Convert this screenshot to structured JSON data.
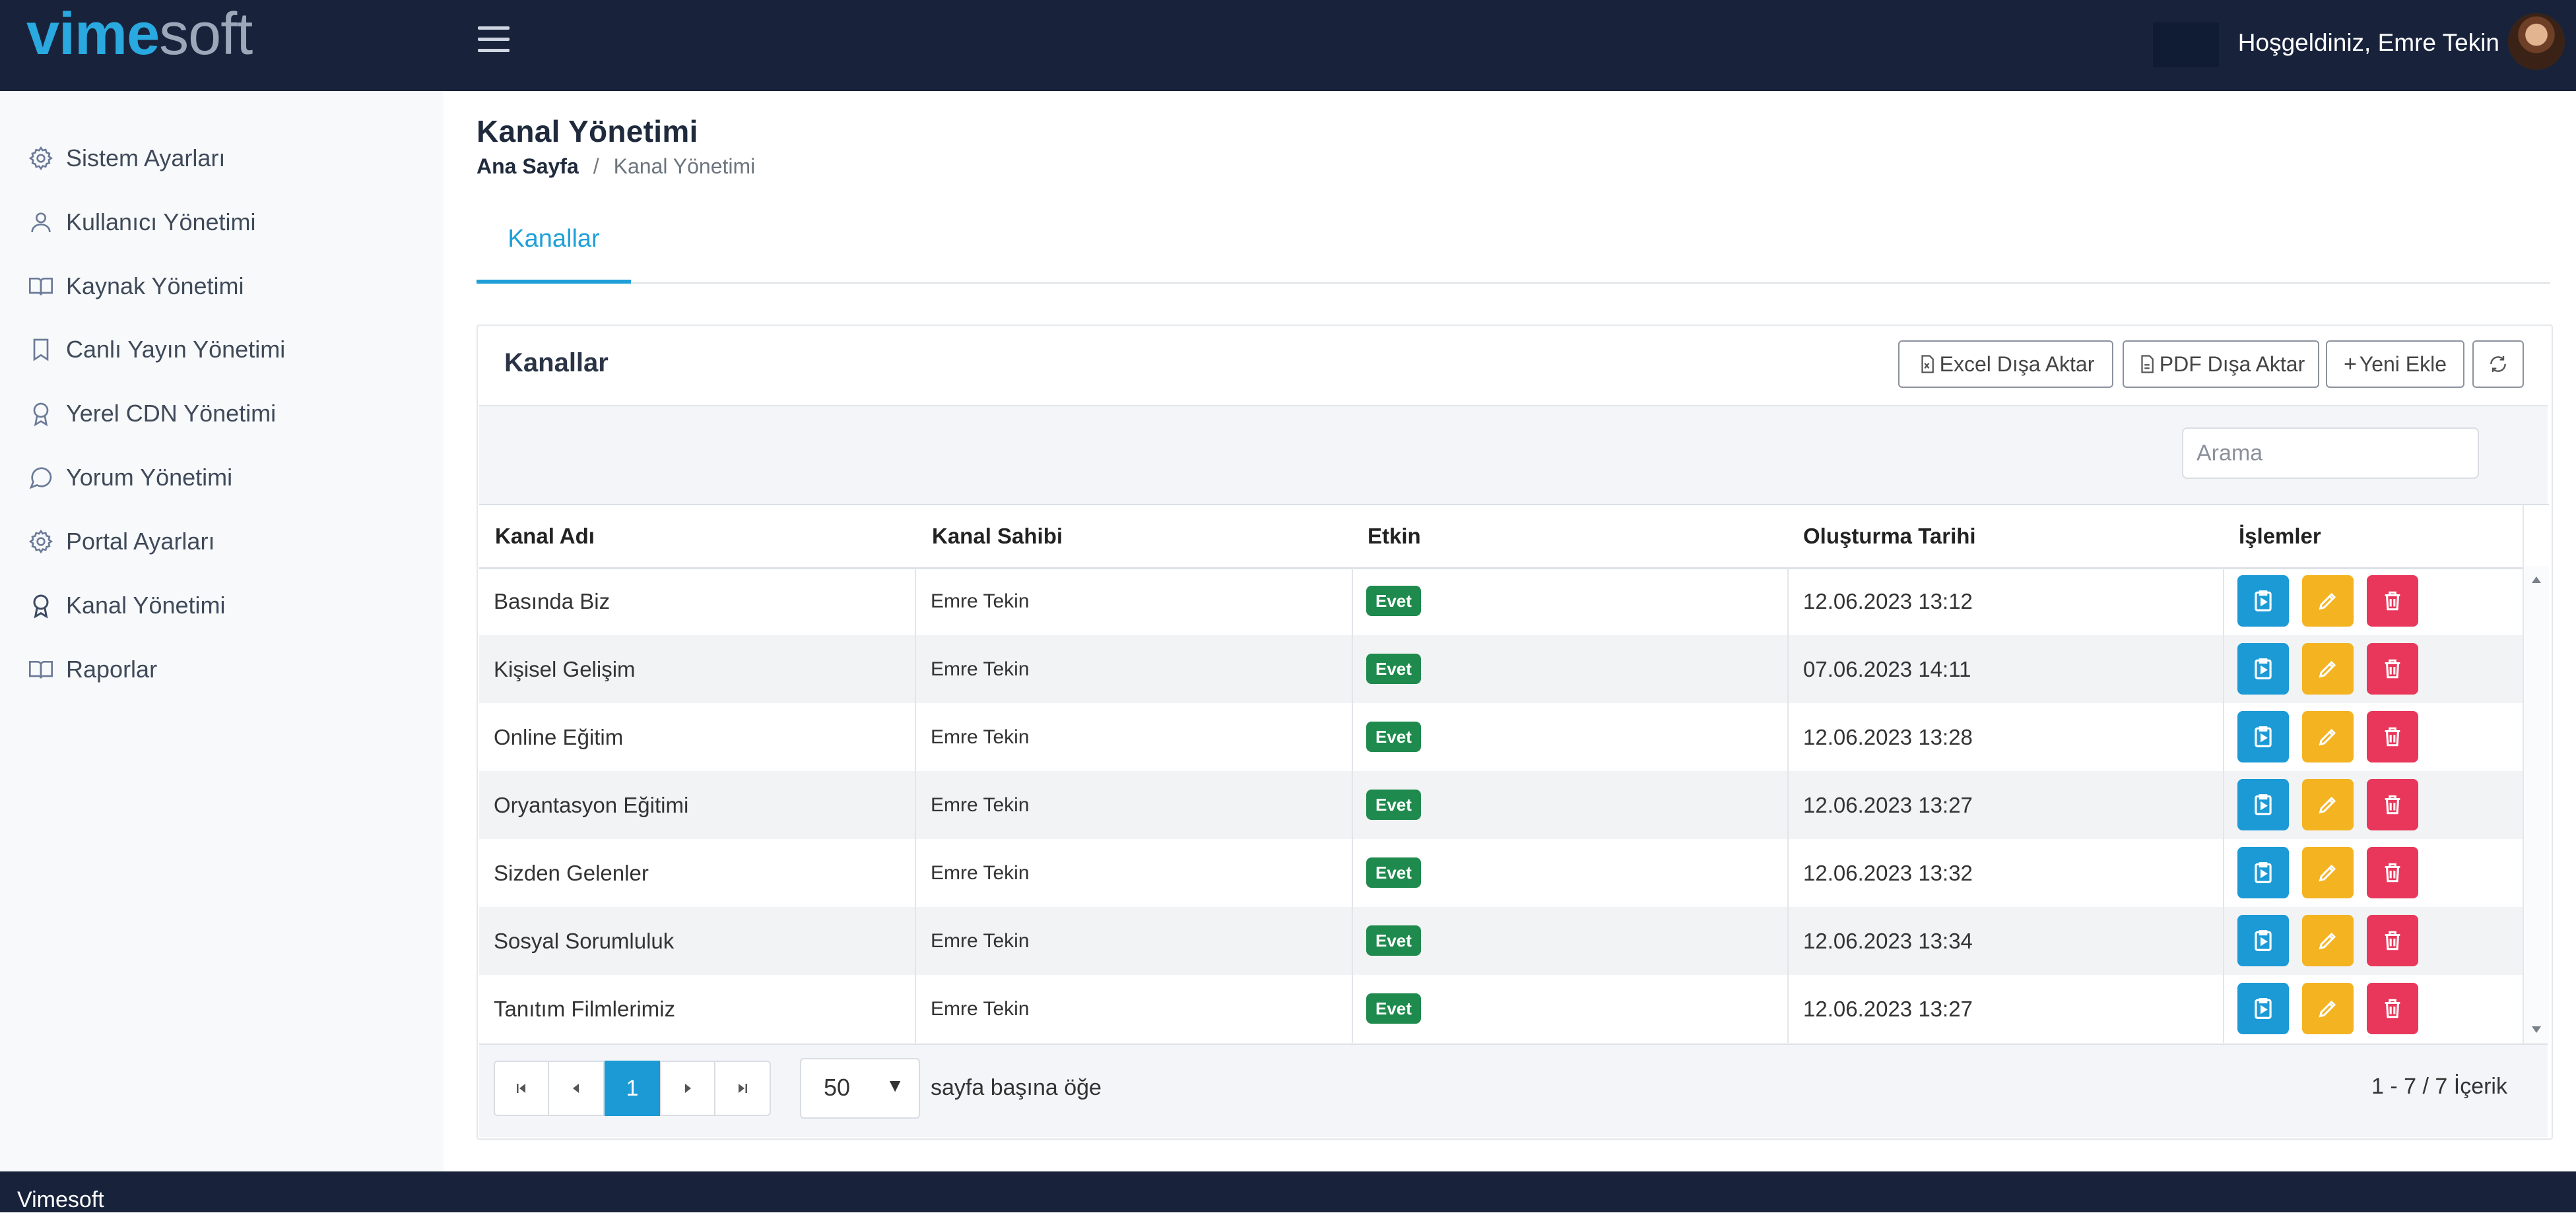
{
  "header": {
    "logo_part1": "vime",
    "logo_part2": "soft",
    "welcome": "Hoşgeldiniz, Emre Tekin"
  },
  "sidebar": {
    "items": [
      {
        "label": "Sistem Ayarları",
        "icon": "gear-icon"
      },
      {
        "label": "Kullanıcı Yönetimi",
        "icon": "user-icon"
      },
      {
        "label": "Kaynak Yönetimi",
        "icon": "book-icon"
      },
      {
        "label": "Canlı Yayın Yönetimi",
        "icon": "bookmark-icon"
      },
      {
        "label": "Yerel CDN Yönetimi",
        "icon": "award-icon"
      },
      {
        "label": "Yorum Yönetimi",
        "icon": "chat-icon"
      },
      {
        "label": "Portal Ayarları",
        "icon": "gear-icon"
      },
      {
        "label": "Kanal Yönetimi",
        "icon": "award-icon"
      },
      {
        "label": "Raporlar",
        "icon": "book-icon"
      }
    ]
  },
  "page": {
    "title": "Kanal Yönetimi",
    "breadcrumb_home": "Ana Sayfa",
    "breadcrumb_sep": "/",
    "breadcrumb_current": "Kanal Yönetimi",
    "tab": "Kanallar"
  },
  "card": {
    "title": "Kanallar",
    "excel_label": "Excel Dışa Aktar",
    "pdf_label": "PDF Dışa Aktar",
    "add_label": "Yeni Ekle",
    "search_placeholder": "Arama"
  },
  "table": {
    "columns": [
      "Kanal Adı",
      "Kanal Sahibi",
      "Etkin",
      "Oluşturma Tarihi",
      "İşlemler"
    ],
    "rows": [
      {
        "name": "Basında Biz",
        "owner": "Emre Tekin",
        "active": "Evet",
        "created": "12.06.2023 13:12"
      },
      {
        "name": "Kişisel Gelişim",
        "owner": "Emre Tekin",
        "active": "Evet",
        "created": "07.06.2023 14:11"
      },
      {
        "name": "Online Eğitim",
        "owner": "Emre Tekin",
        "active": "Evet",
        "created": "12.06.2023 13:28"
      },
      {
        "name": "Oryantasyon Eğitimi",
        "owner": "Emre Tekin",
        "active": "Evet",
        "created": "12.06.2023 13:27"
      },
      {
        "name": "Sizden Gelenler",
        "owner": "Emre Tekin",
        "active": "Evet",
        "created": "12.06.2023 13:32"
      },
      {
        "name": "Sosyal Sorumluluk",
        "owner": "Emre Tekin",
        "active": "Evet",
        "created": "12.06.2023 13:34"
      },
      {
        "name": "Tanıtım Filmlerimiz",
        "owner": "Emre Tekin",
        "active": "Evet",
        "created": "12.06.2023 13:27"
      }
    ]
  },
  "pager": {
    "current_page": "1",
    "page_size": "50",
    "page_size_label": "sayfa başına öğe",
    "count": "1 - 7 / 7 İçerik"
  },
  "footer": {
    "text": "Vimesoft"
  },
  "colors": {
    "header_bg": "#18233b",
    "accent": "#1b9ad6",
    "edit": "#f4b321",
    "delete": "#e8375a",
    "badge": "#1f8a4d"
  }
}
